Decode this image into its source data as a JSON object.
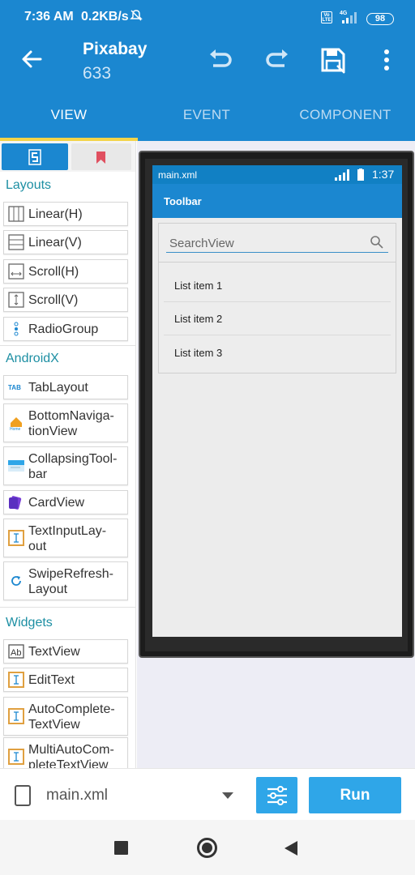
{
  "status_bar": {
    "time": "7:36 AM",
    "speed": "0.2KB/s",
    "network": "4G",
    "volte": "Vo LTE",
    "battery": "98"
  },
  "app_bar": {
    "title": "Pixabay",
    "subtitle": "633"
  },
  "tabs": [
    {
      "label": "VIEW",
      "active": true
    },
    {
      "label": "EVENT",
      "active": false
    },
    {
      "label": "COMPONENT",
      "active": false
    }
  ],
  "palette": {
    "sections": {
      "layouts": "Layouts",
      "androidx": "AndroidX",
      "widgets": "Widgets"
    },
    "layouts": [
      {
        "label": "Linear(H)",
        "icon": "linear-horizontal-icon"
      },
      {
        "label": "Linear(V)",
        "icon": "linear-vertical-icon"
      },
      {
        "label": "Scroll(H)",
        "icon": "scroll-horizontal-icon"
      },
      {
        "label": "Scroll(V)",
        "icon": "scroll-vertical-icon"
      },
      {
        "label": "RadioGroup",
        "icon": "radiogroup-icon"
      }
    ],
    "androidx": [
      {
        "label": "TabLayout",
        "icon": "tab-icon"
      },
      {
        "label": "BottomNaviga-\ntionView",
        "icon": "home-icon"
      },
      {
        "label": "CollapsingTool-\nbar",
        "icon": "toolbar-icon"
      },
      {
        "label": "CardView",
        "icon": "card-icon"
      },
      {
        "label": "TextInputLay-\nout",
        "icon": "textinput-icon"
      },
      {
        "label": "SwipeRefresh-\nLayout",
        "icon": "refresh-icon"
      }
    ],
    "widgets": [
      {
        "label": "TextView",
        "icon": "textview-icon"
      },
      {
        "label": "EditText",
        "icon": "edittext-icon"
      },
      {
        "label": "AutoComplete-\nTextView",
        "icon": "edittext-icon"
      },
      {
        "label": "MultiAutoCom-\npleteTextView",
        "icon": "edittext-icon"
      }
    ]
  },
  "preview": {
    "file": "main.xml",
    "clock": "1:37",
    "toolbar_title": "Toolbar",
    "search_placeholder": "SearchView",
    "list_items": [
      "List item 1",
      "List item 2",
      "List item 3"
    ]
  },
  "bottom_bar": {
    "file": "main.xml",
    "run_label": "Run"
  },
  "colors": {
    "primary": "#1b87d0",
    "accent": "#f3d449",
    "section": "#1d8fa3",
    "run": "#2fa6e8"
  }
}
